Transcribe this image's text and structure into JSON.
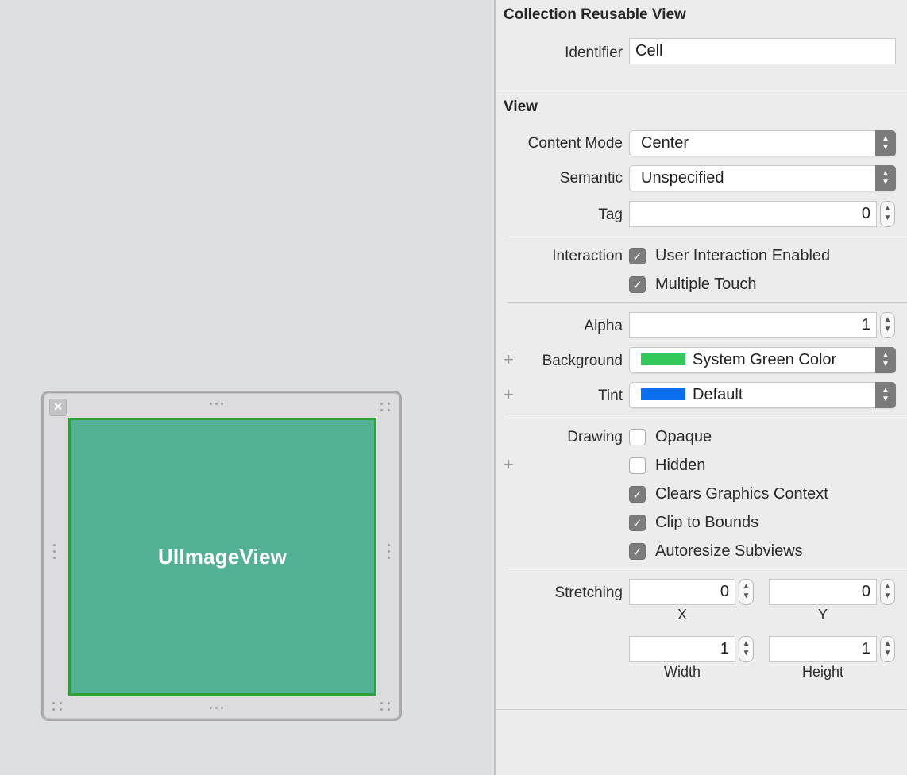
{
  "canvas": {
    "image_view_label": "UIImageView"
  },
  "inspector": {
    "collection_section": {
      "title": "Collection Reusable View",
      "identifier_label": "Identifier",
      "identifier_value": "Cell"
    },
    "view_section": {
      "title": "View",
      "content_mode_label": "Content Mode",
      "content_mode_value": "Center",
      "semantic_label": "Semantic",
      "semantic_value": "Unspecified",
      "tag_label": "Tag",
      "tag_value": "0",
      "interaction_label": "Interaction",
      "user_interaction": {
        "label": "User Interaction Enabled",
        "checked": true
      },
      "multiple_touch": {
        "label": "Multiple Touch",
        "checked": true
      },
      "alpha_label": "Alpha",
      "alpha_value": "1",
      "background_label": "Background",
      "background_value": "System Green Color",
      "background_color": "#34c759",
      "tint_label": "Tint",
      "tint_value": "Default",
      "tint_color": "#0a70f0",
      "drawing_label": "Drawing",
      "opaque": {
        "label": "Opaque",
        "checked": false
      },
      "hidden": {
        "label": "Hidden",
        "checked": false
      },
      "clears_graphics": {
        "label": "Clears Graphics Context",
        "checked": true
      },
      "clip_to_bounds": {
        "label": "Clip to Bounds",
        "checked": true
      },
      "autoresize": {
        "label": "Autoresize Subviews",
        "checked": true
      },
      "stretching_label": "Stretching",
      "stretch_x": "0",
      "stretch_y": "0",
      "stretch_width": "1",
      "stretch_height": "1",
      "x_label": "X",
      "y_label": "Y",
      "width_label": "Width",
      "height_label": "Height"
    }
  }
}
